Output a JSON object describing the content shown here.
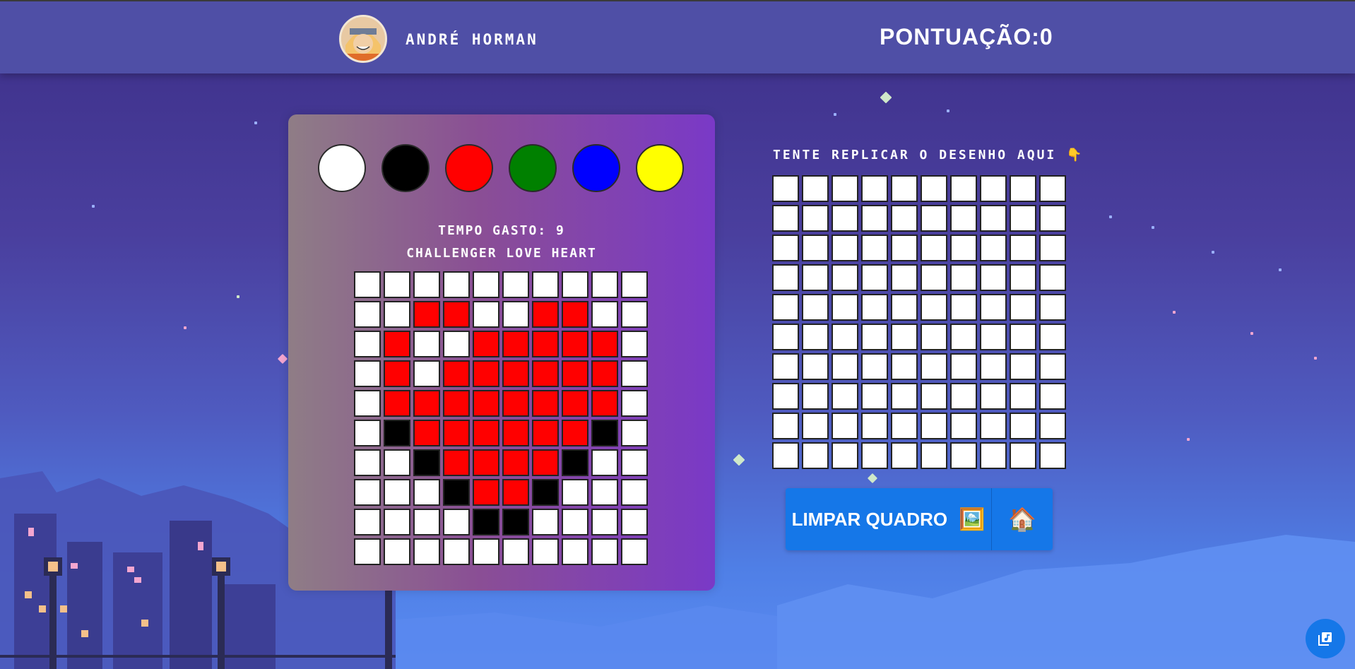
{
  "header": {
    "username": "ANDRÉ HORMAN",
    "score_label": "PONTUAÇÃO:",
    "score_value": "0"
  },
  "palette": {
    "colors": [
      "#ffffff",
      "#000000",
      "#ff0000",
      "#008000",
      "#0000ff",
      "#ffff00"
    ]
  },
  "challenge": {
    "time_label": "TEMPO GASTO:",
    "time_value": "9",
    "title": "CHALLENGER LOVE HEART",
    "grid": [
      [
        "w",
        "w",
        "w",
        "w",
        "w",
        "w",
        "w",
        "w",
        "w",
        "w"
      ],
      [
        "w",
        "w",
        "r",
        "r",
        "w",
        "w",
        "r",
        "r",
        "w",
        "w"
      ],
      [
        "w",
        "r",
        "w",
        "w",
        "r",
        "r",
        "r",
        "r",
        "r",
        "w"
      ],
      [
        "w",
        "r",
        "w",
        "r",
        "r",
        "r",
        "r",
        "r",
        "r",
        "w"
      ],
      [
        "w",
        "r",
        "r",
        "r",
        "r",
        "r",
        "r",
        "r",
        "r",
        "w"
      ],
      [
        "w",
        "k",
        "r",
        "r",
        "r",
        "r",
        "r",
        "r",
        "k",
        "w"
      ],
      [
        "w",
        "w",
        "k",
        "r",
        "r",
        "r",
        "r",
        "k",
        "w",
        "w"
      ],
      [
        "w",
        "w",
        "w",
        "k",
        "r",
        "r",
        "k",
        "w",
        "w",
        "w"
      ],
      [
        "w",
        "w",
        "w",
        "w",
        "k",
        "k",
        "w",
        "w",
        "w",
        "w"
      ],
      [
        "w",
        "w",
        "w",
        "w",
        "w",
        "w",
        "w",
        "w",
        "w",
        "w"
      ]
    ]
  },
  "replica": {
    "instruction": "TENTE REPLICAR O DESENHO AQUI 👇",
    "rows": 10,
    "cols": 10
  },
  "actions": {
    "clear_label": "LIMPAR QUADRO",
    "clear_emoji": "🖼️",
    "home_emoji": "🏠"
  }
}
